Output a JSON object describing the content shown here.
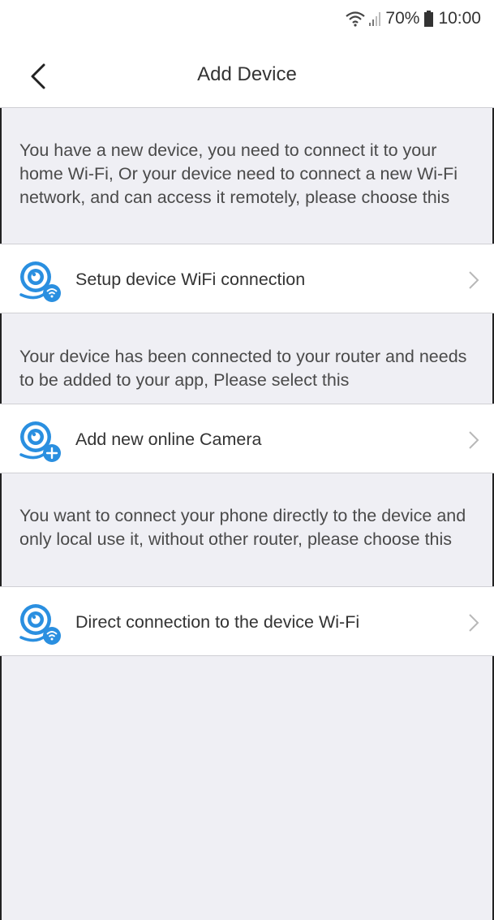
{
  "status_bar": {
    "battery": "70%",
    "time": "10:00"
  },
  "header": {
    "title": "Add Device"
  },
  "sections": [
    {
      "description": "You have a new device, you need to connect it to your home Wi-Fi, Or your device need to connect a new Wi-Fi network, and can access it remotely, please choose this",
      "option_label": "Setup device WiFi connection",
      "icon": "camera-wifi-icon"
    },
    {
      "description": "Your device has been connected to your router and needs to be added to your app, Please select this",
      "option_label": "Add new online Camera",
      "icon": "camera-add-icon"
    },
    {
      "description": "You want to connect your phone directly to the device and only local use it, without other router, please choose this",
      "option_label": "Direct connection to the device Wi-Fi",
      "icon": "camera-wifi-icon"
    }
  ],
  "colors": {
    "accent": "#2a8fe0",
    "background": "#efeff4",
    "divider": "#cfcfd4"
  }
}
